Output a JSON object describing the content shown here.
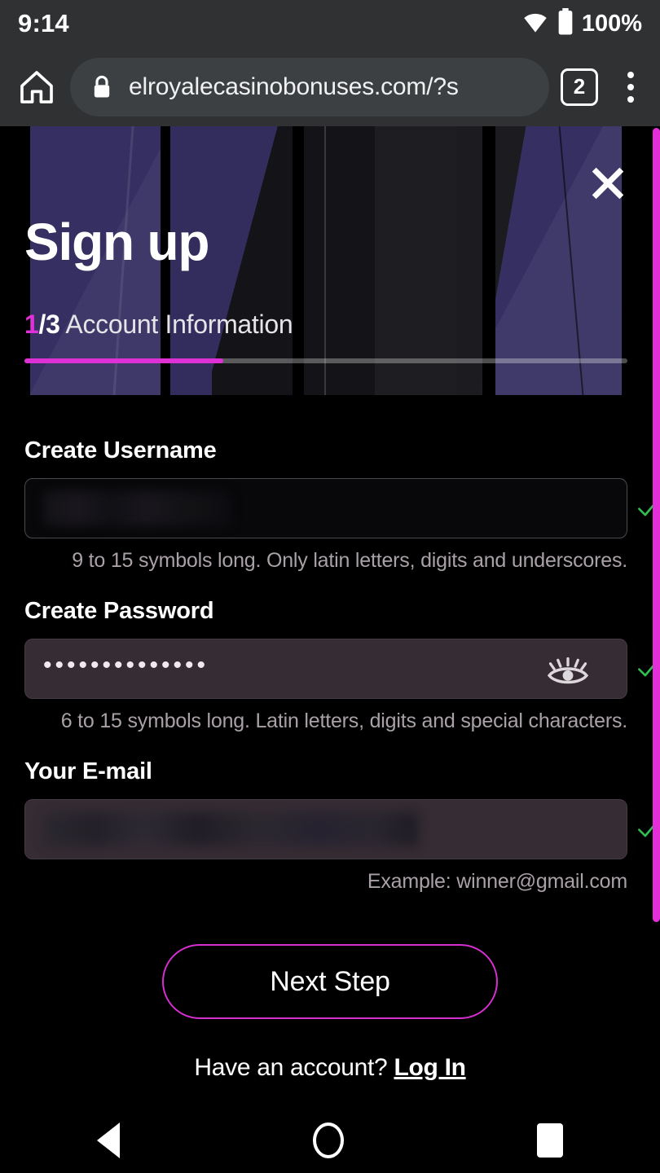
{
  "status_bar": {
    "time": "9:14",
    "wifi_icon": "wifi-icon",
    "battery_icon": "battery-icon",
    "battery_text": "100%"
  },
  "browser": {
    "home_icon": "home-icon",
    "lock_icon": "lock-icon",
    "url": "elroyalecasinobonuses.com/?s",
    "tab_count": "2",
    "menu_icon": "overflow-menu-icon"
  },
  "modal": {
    "close_icon": "close-icon",
    "title": "Sign up",
    "step_current": "1",
    "step_total": "/3",
    "step_label": " Account Information",
    "progress_percent": 33
  },
  "fields": {
    "username": {
      "label": "Create Username",
      "value": "",
      "helper": "9 to 15 symbols long. Only latin letters, digits and underscores.",
      "valid_icon": "check-icon"
    },
    "password": {
      "label": "Create Password",
      "value": "••••••••••••••",
      "helper": "6 to 15 symbols long. Latin letters, digits and special characters.",
      "toggle_icon": "eye-icon",
      "valid_icon": "check-icon"
    },
    "email": {
      "label": "Your E-mail",
      "value": "",
      "helper": "Example: winner@gmail.com",
      "valid_icon": "check-icon"
    }
  },
  "actions": {
    "next_step": "Next Step",
    "have_account_text": "Have an account? ",
    "login_link": "Log In"
  },
  "nav_bar": {
    "back_icon": "back-triangle-icon",
    "home_icon": "home-circle-icon",
    "recents_icon": "recents-square-icon"
  },
  "colors": {
    "accent_magenta": "#dd31d6",
    "valid_green": "#2fc14f",
    "toolbar_gray": "#2f3133",
    "hero_navy": "#353061"
  }
}
